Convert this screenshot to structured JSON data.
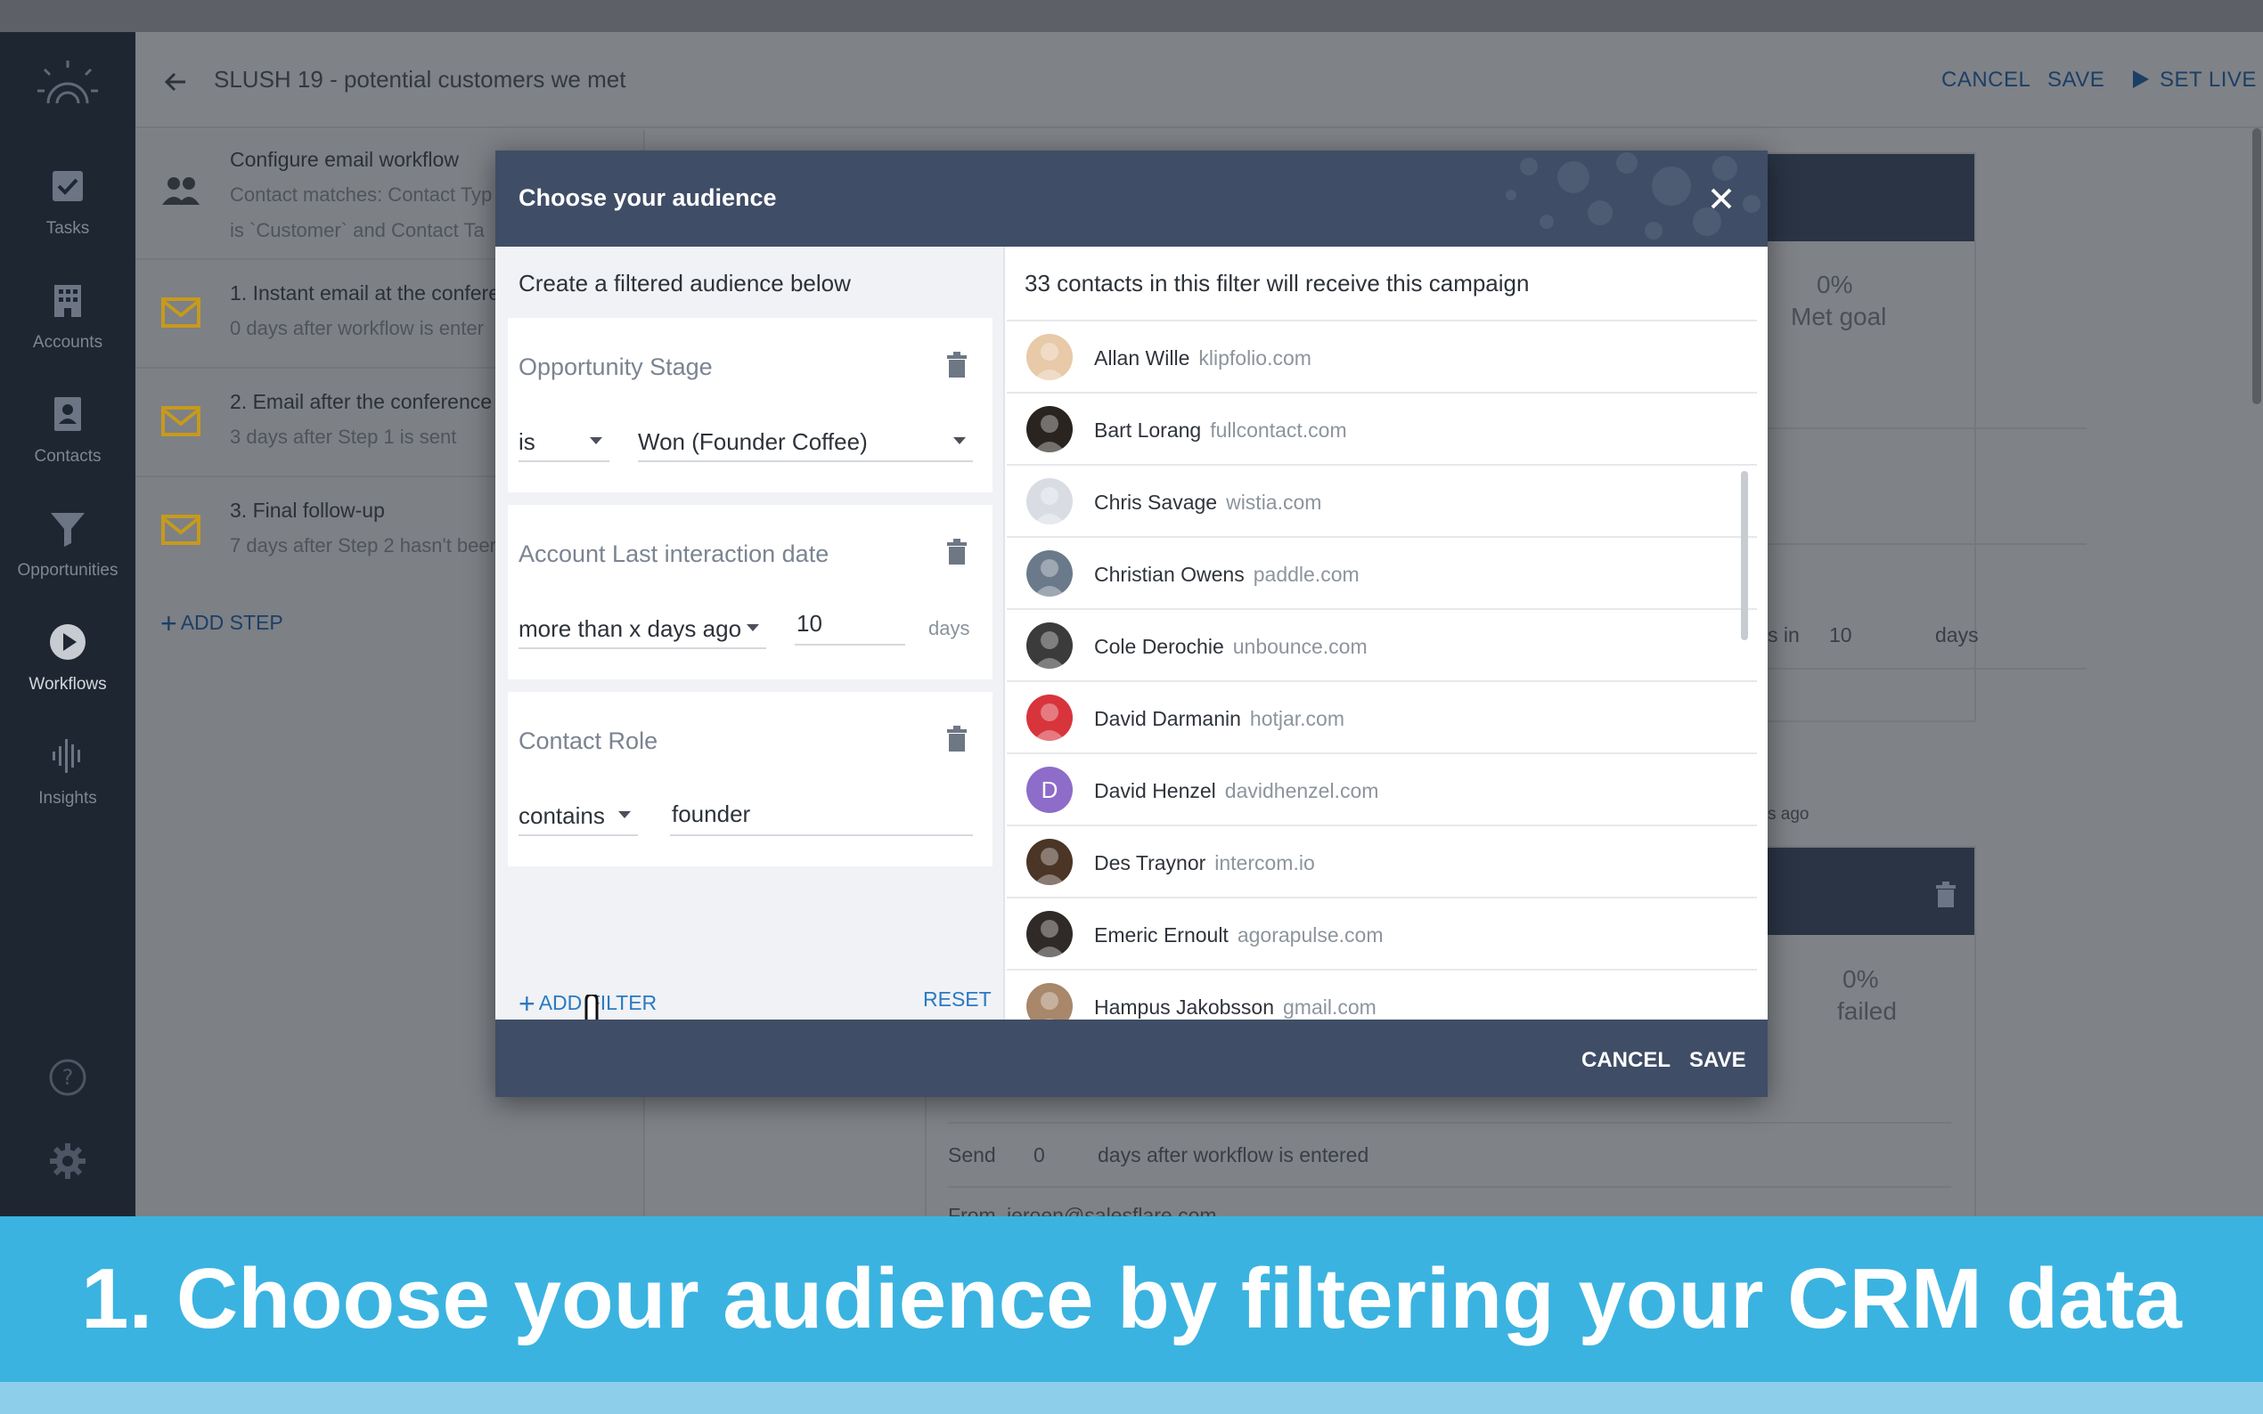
{
  "sidebar": {
    "items": [
      {
        "label": "Tasks",
        "icon": "check-square-icon"
      },
      {
        "label": "Accounts",
        "icon": "building-icon"
      },
      {
        "label": "Contacts",
        "icon": "contact-card-icon"
      },
      {
        "label": "Opportunities",
        "icon": "funnel-icon"
      },
      {
        "label": "Workflows",
        "icon": "play-circle-icon"
      },
      {
        "label": "Insights",
        "icon": "audio-bars-icon"
      }
    ],
    "active": "Workflows"
  },
  "header": {
    "title": "SLUSH 19 - potential customers we met",
    "cancel": "CANCEL",
    "save": "SAVE",
    "set_live": "SET LIVE"
  },
  "workflow": {
    "config": {
      "title": "Configure email workflow",
      "line1": "Contact matches: Contact Typ",
      "line2": "is `Customer` and Contact Ta"
    },
    "steps": [
      {
        "title": "1. Instant email at the confere",
        "sub": "0 days after workflow is enter"
      },
      {
        "title": "2. Email after the conference",
        "sub": "3 days after Step 1 is sent"
      },
      {
        "title": "3. Final follow-up",
        "sub": "7 days after Step 2 hasn't beer"
      }
    ],
    "add_step": "ADD STEP"
  },
  "background_stats": {
    "met_goal_pct": "0%",
    "met_goal_label": "Met goal",
    "failed_pct": "0%",
    "failed_label": "failed",
    "frag_in": "s in",
    "frag_days_value": "10",
    "frag_days": "days",
    "frag_ago": "s ago",
    "send_label": "Send",
    "send_value": "0",
    "send_suffix": "days after workflow is entered",
    "from_label": "From",
    "from_value": "jeroen@salesflare.com"
  },
  "modal": {
    "title": "Choose your audience",
    "filter_heading": "Create a filtered audience below",
    "filters": [
      {
        "title": "Opportunity Stage",
        "operator": "is",
        "value": "Won (Founder Coffee)",
        "unit": ""
      },
      {
        "title": "Account Last interaction date",
        "operator": "more than x days ago",
        "value": "10",
        "unit": "days"
      },
      {
        "title": "Contact Role",
        "operator": "contains",
        "value": "founder",
        "unit": ""
      }
    ],
    "add_filter": "ADD FILTER",
    "reset": "RESET",
    "contacts_heading": "33 contacts in this filter will receive this campaign",
    "contacts": [
      {
        "name": "Allan Wille",
        "domain": "klipfolio.com",
        "color": "#e8c9a8"
      },
      {
        "name": "Bart Lorang",
        "domain": "fullcontact.com",
        "color": "#2a2420"
      },
      {
        "name": "Chris Savage",
        "domain": "wistia.com",
        "color": "#d9dde3"
      },
      {
        "name": "Christian Owens",
        "domain": "paddle.com",
        "color": "#6a7a8a"
      },
      {
        "name": "Cole Derochie",
        "domain": "unbounce.com",
        "color": "#3b3b3b"
      },
      {
        "name": "David Darmanin",
        "domain": "hotjar.com",
        "color": "#d8343c"
      },
      {
        "name": "David Henzel",
        "domain": "davidhenzel.com",
        "color": "#8e6cc9",
        "initial": "D"
      },
      {
        "name": "Des Traynor",
        "domain": "intercom.io",
        "color": "#4a3526"
      },
      {
        "name": "Emeric Ernoult",
        "domain": "agorapulse.com",
        "color": "#2f2a28"
      },
      {
        "name": "Hampus Jakobsson",
        "domain": "gmail.com",
        "color": "#a8876a"
      }
    ],
    "cancel": "CANCEL",
    "save": "SAVE"
  },
  "caption": "1. Choose your audience by filtering your CRM data",
  "colors": {
    "modal_header": "#3f4d66",
    "link_blue": "#2a79c3",
    "caption_bg": "#3bb3e0",
    "sidebar_bg": "#1e2631"
  }
}
